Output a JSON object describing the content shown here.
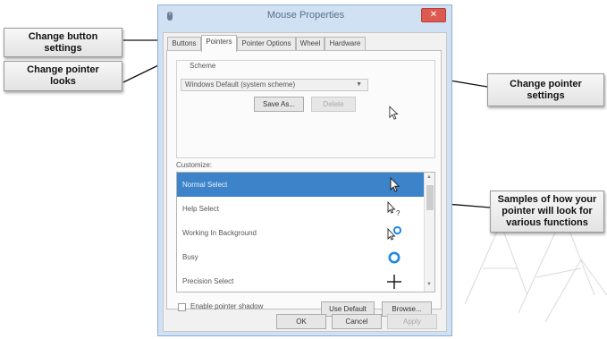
{
  "dialog": {
    "title": "Mouse Properties",
    "close_label": "✕",
    "tabs": [
      "Buttons",
      "Pointers",
      "Pointer Options",
      "Wheel",
      "Hardware"
    ],
    "active_tab": "Pointers",
    "scheme": {
      "group_label": "Scheme",
      "selected": "Windows Default (system scheme)",
      "save_as_label": "Save As...",
      "delete_label": "Delete"
    },
    "customize": {
      "label": "Customize:",
      "items": [
        {
          "label": "Normal Select",
          "pointer": "arrow-pointer-icon"
        },
        {
          "label": "Help Select",
          "pointer": "help-pointer-icon"
        },
        {
          "label": "Working In Background",
          "pointer": "working-pointer-icon"
        },
        {
          "label": "Busy",
          "pointer": "busy-pointer-icon"
        },
        {
          "label": "Precision Select",
          "pointer": "crosshair-pointer-icon"
        }
      ],
      "selected_index": 0
    },
    "enable_shadow_label": "Enable pointer shadow",
    "enable_shadow_checked": false,
    "use_default_label": "Use Default",
    "browse_label": "Browse...",
    "ok_label": "OK",
    "cancel_label": "Cancel",
    "apply_label": "Apply"
  },
  "callouts": {
    "button_settings": "Change button\nsettings",
    "pointer_looks": "Change pointer\nlooks",
    "pointer_settings": "Change pointer\nsettings",
    "samples": "Samples of how your\npointer will look for\nvarious functions"
  },
  "colors": {
    "accent": "#3d83c9",
    "busy_ring": "#1e88e5",
    "close_button": "#dd5a52",
    "titlebar": "#cfe1f2"
  }
}
